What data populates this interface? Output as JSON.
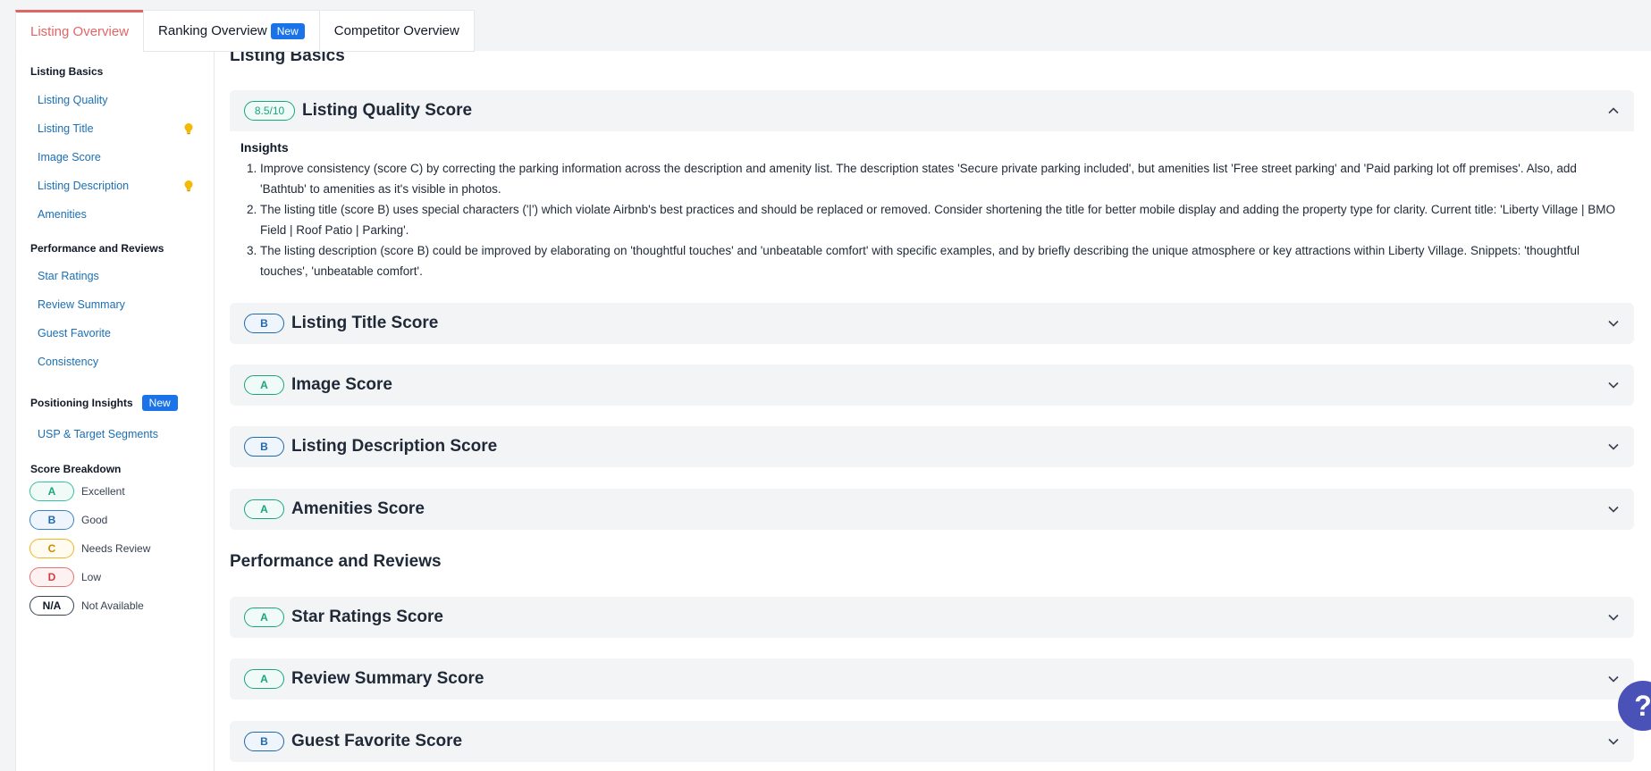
{
  "tabs": {
    "listing_overview": "Listing Overview",
    "ranking_overview": "Ranking Overview",
    "ranking_new_badge": "New",
    "competitor_overview": "Competitor Overview"
  },
  "sidebar": {
    "listing_basics": {
      "heading": "Listing Basics",
      "items": [
        "Listing Quality",
        "Listing Title",
        "Image Score",
        "Listing Description",
        "Amenities"
      ]
    },
    "performance": {
      "heading": "Performance and Reviews",
      "items": [
        "Star Ratings",
        "Review Summary",
        "Guest Favorite",
        "Consistency"
      ]
    },
    "positioning": {
      "heading": "Positioning Insights",
      "new_badge": "New",
      "items": [
        "USP & Target Segments"
      ]
    },
    "score_breakdown": {
      "heading": "Score Breakdown",
      "legend": [
        {
          "grade": "A",
          "label": "Excellent"
        },
        {
          "grade": "B",
          "label": "Good"
        },
        {
          "grade": "C",
          "label": "Needs Review"
        },
        {
          "grade": "D",
          "label": "Low"
        },
        {
          "grade": "N/A",
          "label": "Not Available"
        }
      ]
    }
  },
  "main": {
    "listing_basics_title": "Listing Basics",
    "quality_card": {
      "score": "8.5/10",
      "title": "Listing Quality Score",
      "insights_heading": "Insights",
      "insights": [
        "Improve consistency (score C) by correcting the parking information across the description and amenity list. The description states 'Secure private parking included', but amenities list 'Free street parking' and 'Paid parking lot off premises'. Also, add 'Bathtub' to amenities as it's visible in photos.",
        "The listing title (score B) uses special characters ('|') which violate Airbnb's best practices and should be replaced or removed. Consider shortening the title for better mobile display and adding the property type for clarity. Current title: 'Liberty Village | BMO Field | Roof Patio | Parking'.",
        "The listing description (score B) could be improved by elaborating on 'thoughtful touches' and 'unbeatable comfort' with specific examples, and by briefly describing the unique atmosphere or key attractions within Liberty Village. Snippets: 'thoughtful touches', 'unbeatable comfort'."
      ]
    },
    "basics_cards": [
      {
        "grade": "B",
        "title": "Listing Title Score"
      },
      {
        "grade": "A",
        "title": "Image Score"
      },
      {
        "grade": "B",
        "title": "Listing Description Score"
      },
      {
        "grade": "A",
        "title": "Amenities Score"
      }
    ],
    "performance_title": "Performance and Reviews",
    "performance_cards": [
      {
        "grade": "A",
        "title": "Star Ratings Score"
      },
      {
        "grade": "A",
        "title": "Review Summary Score"
      },
      {
        "grade": "B",
        "title": "Guest Favorite Score"
      }
    ]
  },
  "help_button": "?"
}
